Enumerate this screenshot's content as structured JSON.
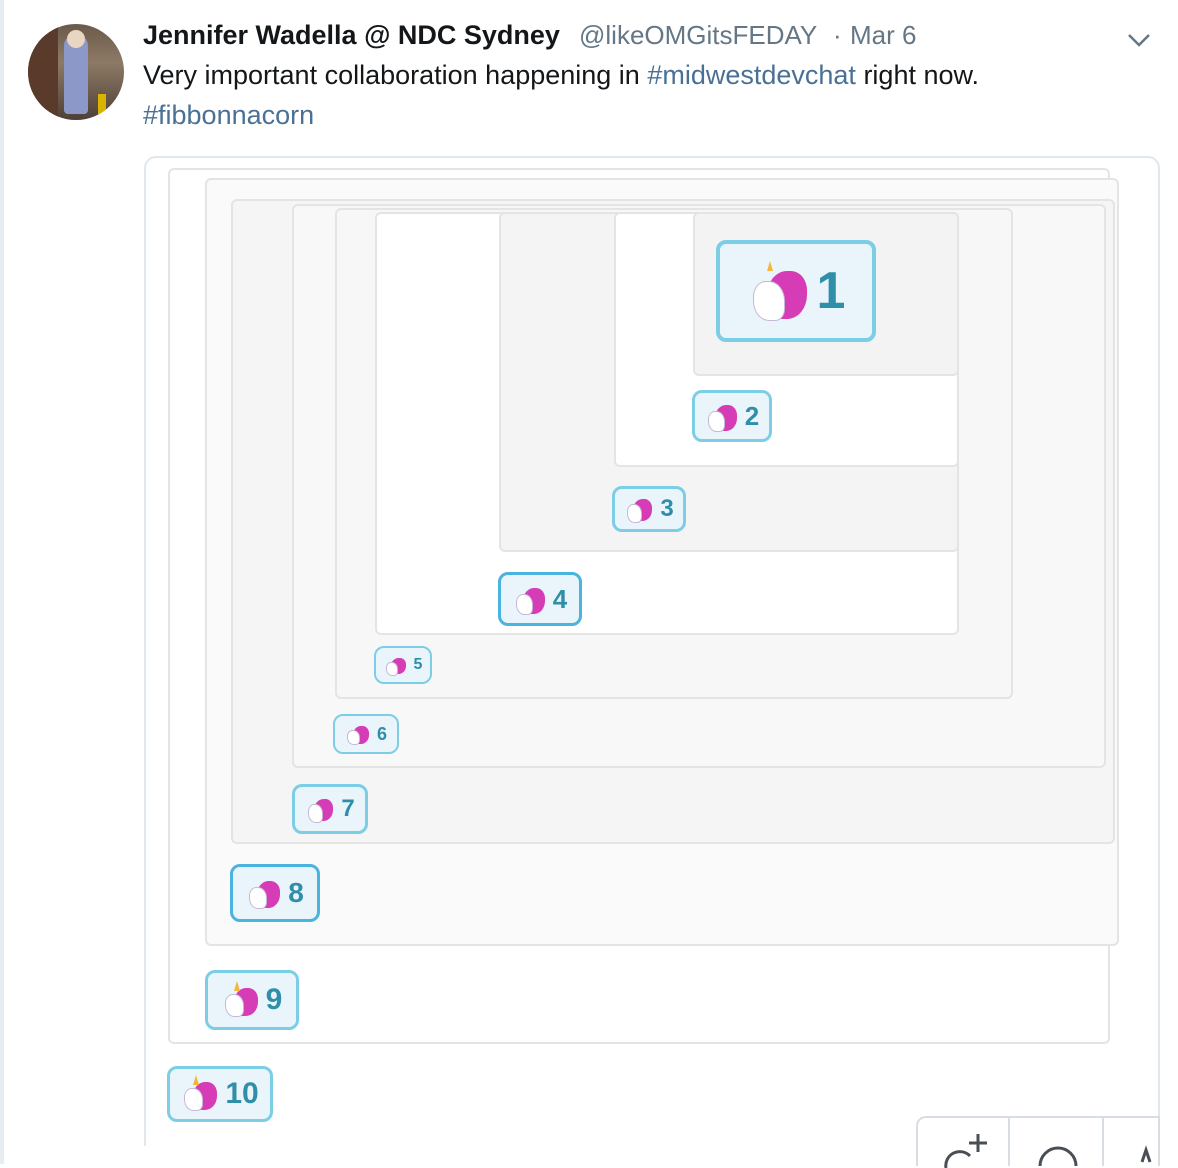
{
  "tweet": {
    "author_name": "Jennifer Wadella @ NDC Sydney",
    "handle": "@likeOMGitsFEDAY",
    "separator": "·",
    "date": "Mar 6",
    "text_before": "Very important collaboration happening in ",
    "hashtag1": "#midwestdevchat",
    "text_after": " right now.",
    "hashtag2": "#fibbonnacorn"
  },
  "reactions": [
    {
      "label": "1"
    },
    {
      "label": "2"
    },
    {
      "label": "3"
    },
    {
      "label": "4"
    },
    {
      "label": "5"
    },
    {
      "label": "6"
    },
    {
      "label": "7"
    },
    {
      "label": "8"
    },
    {
      "label": "9"
    },
    {
      "label": "10"
    }
  ],
  "icons": {
    "more": "chevron-down-icon",
    "reaction_emoji": "unicorn-icon",
    "add_reaction": "add-reaction-icon",
    "comment": "comment-icon"
  },
  "colors": {
    "link": "#4a7195",
    "muted": "#657786",
    "text": "#14171a",
    "reaction_border": "#7ccde6",
    "reaction_text": "#2f8ea8",
    "unicorn_mane": "#d63cb5"
  }
}
